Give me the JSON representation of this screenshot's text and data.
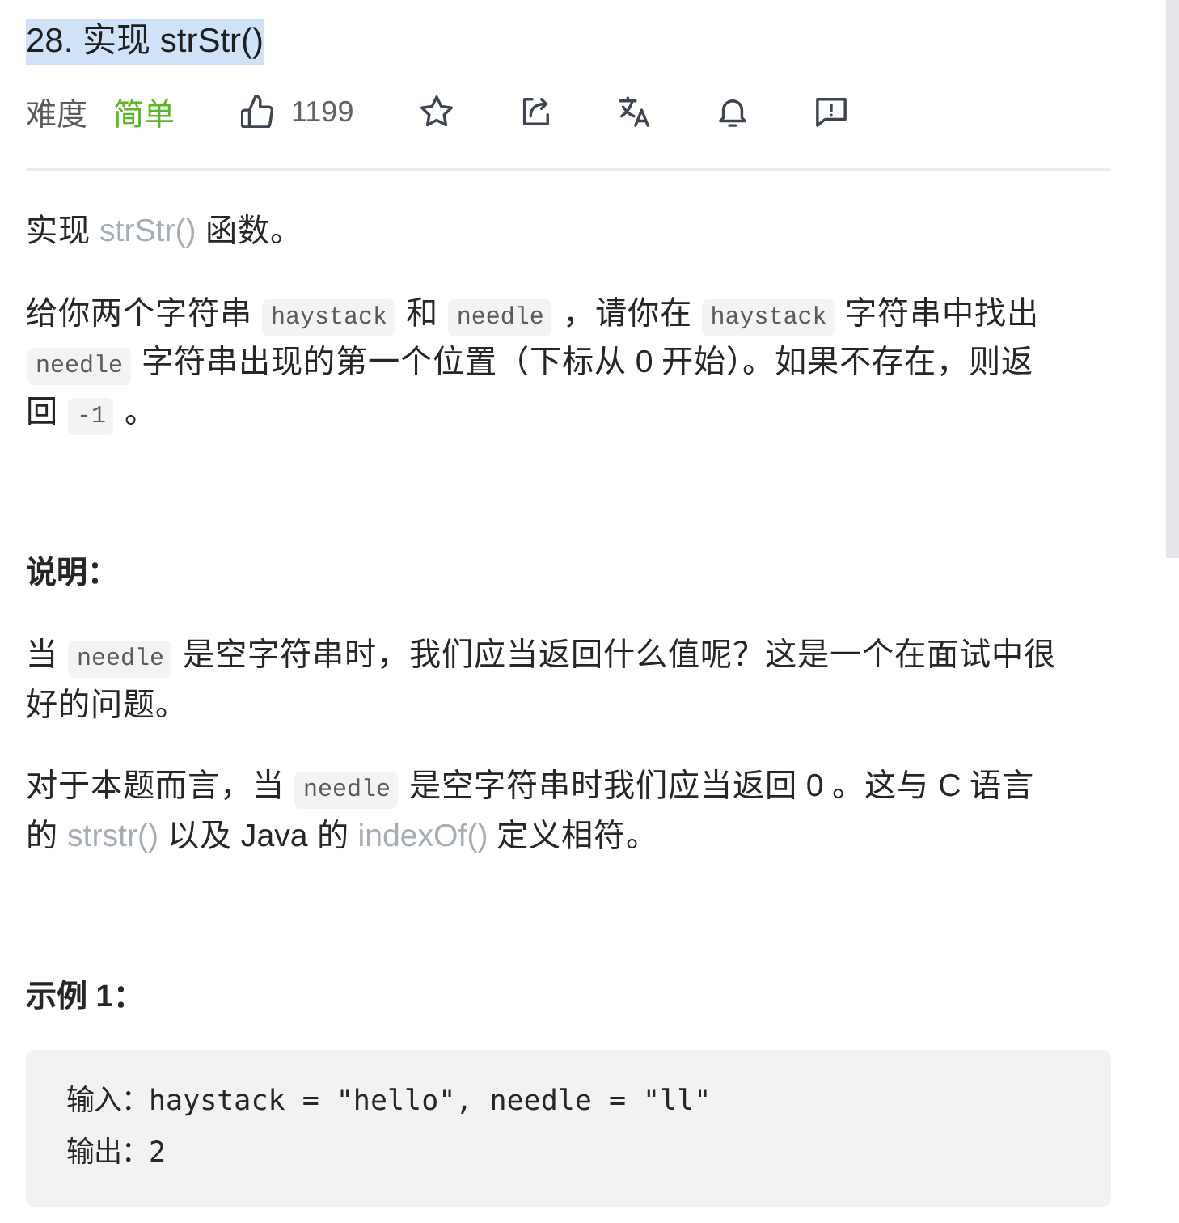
{
  "title": {
    "text": "28. 实现 strStr()",
    "highlighted": true
  },
  "toolbar": {
    "difficulty_label": "难度",
    "difficulty": "简单",
    "likes": "1199"
  },
  "content": [
    {
      "kind": "paragraph",
      "parts": [
        {
          "kind": "text",
          "text": "实现 "
        },
        {
          "kind": "link",
          "text": "strStr()"
        },
        {
          "kind": "text",
          "text": " 函数。"
        }
      ]
    },
    {
      "kind": "paragraph",
      "parts": [
        {
          "kind": "text",
          "text": "给你两个字符串 "
        },
        {
          "kind": "code",
          "text": "haystack"
        },
        {
          "kind": "text",
          "text": " 和 "
        },
        {
          "kind": "code",
          "text": "needle"
        },
        {
          "kind": "text",
          "text": " ，请你在 "
        },
        {
          "kind": "code",
          "text": "haystack"
        },
        {
          "kind": "text",
          "text": " 字符串中找出 "
        },
        {
          "kind": "code",
          "text": "needle"
        },
        {
          "kind": "text",
          "text": " 字符串出现的第一个位置（下标从 0 开始）。如果不存在，则返回 "
        },
        {
          "kind": "code",
          "text": "-1"
        },
        {
          "kind": "text",
          "text": " 。"
        }
      ]
    },
    {
      "kind": "heading",
      "text": "说明："
    },
    {
      "kind": "paragraph",
      "parts": [
        {
          "kind": "text",
          "text": "当 "
        },
        {
          "kind": "code",
          "text": "needle"
        },
        {
          "kind": "text",
          "text": " 是空字符串时，我们应当返回什么值呢？这是一个在面试中很好的问题。"
        }
      ]
    },
    {
      "kind": "paragraph",
      "parts": [
        {
          "kind": "text",
          "text": "对于本题而言，当 "
        },
        {
          "kind": "code",
          "text": "needle"
        },
        {
          "kind": "text",
          "text": " 是空字符串时我们应当返回 0 。这与 C 语言的 "
        },
        {
          "kind": "link",
          "text": "strstr()"
        },
        {
          "kind": "text",
          "text": " 以及 Java 的 "
        },
        {
          "kind": "link",
          "text": "indexOf()"
        },
        {
          "kind": "text",
          "text": " 定义相符。"
        }
      ]
    },
    {
      "kind": "heading",
      "text": "示例 1："
    },
    {
      "kind": "pre",
      "lines": [
        "输入：haystack = \"hello\", needle = \"ll\"",
        "输出：2"
      ]
    }
  ]
}
